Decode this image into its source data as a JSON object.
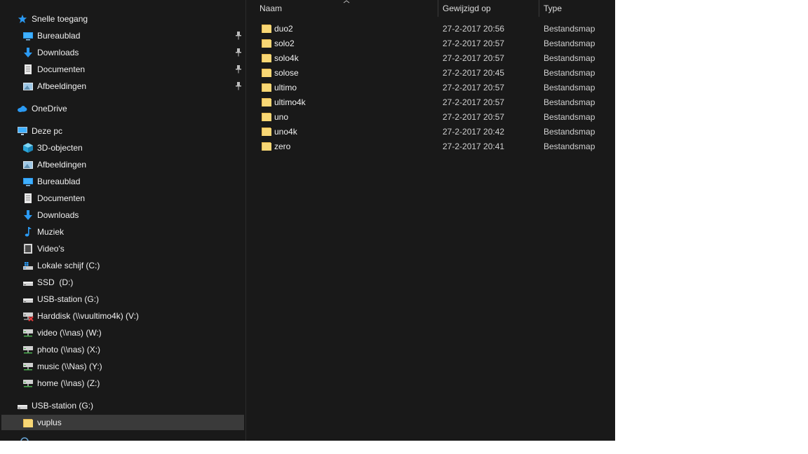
{
  "colors": {
    "background": "#191919",
    "selected": "#3a3a3a",
    "accent_blue": "#2b9af3",
    "folder_yellow": "#f8d775"
  },
  "nav": {
    "items": [
      {
        "label": "Snelle toegang",
        "icon": "star-icon",
        "level": 0,
        "pinned": false
      },
      {
        "label": "Bureaublad",
        "icon": "desktop-icon",
        "level": 1,
        "pinned": true
      },
      {
        "label": "Downloads",
        "icon": "download-arrow-icon",
        "level": 1,
        "pinned": true
      },
      {
        "label": "Documenten",
        "icon": "document-icon",
        "level": 1,
        "pinned": true
      },
      {
        "label": "Afbeeldingen",
        "icon": "pictures-icon",
        "level": 1,
        "pinned": true
      },
      {
        "label": "OneDrive",
        "icon": "cloud-icon",
        "level": 0,
        "pinned": false
      },
      {
        "label": "Deze pc",
        "icon": "computer-icon",
        "level": 0,
        "pinned": false
      },
      {
        "label": "3D-objecten",
        "icon": "cube-icon",
        "level": 1,
        "pinned": false
      },
      {
        "label": "Afbeeldingen",
        "icon": "pictures-icon",
        "level": 1,
        "pinned": false
      },
      {
        "label": "Bureaublad",
        "icon": "desktop-icon",
        "level": 1,
        "pinned": false
      },
      {
        "label": "Documenten",
        "icon": "document-icon",
        "level": 1,
        "pinned": false
      },
      {
        "label": "Downloads",
        "icon": "download-arrow-icon",
        "level": 1,
        "pinned": false
      },
      {
        "label": "Muziek",
        "icon": "music-note-icon",
        "level": 1,
        "pinned": false
      },
      {
        "label": "Video's",
        "icon": "film-icon",
        "level": 1,
        "pinned": false
      },
      {
        "label": "Lokale schijf (C:)",
        "icon": "windows-drive-icon",
        "level": 1,
        "pinned": false
      },
      {
        "label": "SSD  (D:)",
        "icon": "drive-icon",
        "level": 1,
        "pinned": false
      },
      {
        "label": "USB-station (G:)",
        "icon": "drive-icon",
        "level": 1,
        "pinned": false
      },
      {
        "label": "Harddisk (\\\\vuultimo4k) (V:)",
        "icon": "disconnected-network-drive-icon",
        "level": 1,
        "pinned": false
      },
      {
        "label": "video (\\\\nas) (W:)",
        "icon": "network-drive-icon",
        "level": 1,
        "pinned": false
      },
      {
        "label": "photo (\\\\nas) (X:)",
        "icon": "network-drive-icon",
        "level": 1,
        "pinned": false
      },
      {
        "label": "music (\\\\Nas) (Y:)",
        "icon": "network-drive-icon",
        "level": 1,
        "pinned": false
      },
      {
        "label": "home (\\\\nas) (Z:)",
        "icon": "network-drive-icon",
        "level": 1,
        "pinned": false
      },
      {
        "label": "USB-station (G:)",
        "icon": "drive-icon",
        "level": 0,
        "pinned": false
      },
      {
        "label": "vuplus",
        "icon": "folder-icon",
        "level": 1,
        "pinned": false,
        "selected": true
      }
    ]
  },
  "content": {
    "columns": {
      "name": "Naam",
      "modified": "Gewijzigd op",
      "type": "Type"
    },
    "rows": [
      {
        "name": "duo2",
        "modified": "27-2-2017 20:56",
        "type": "Bestandsmap"
      },
      {
        "name": "solo2",
        "modified": "27-2-2017 20:57",
        "type": "Bestandsmap"
      },
      {
        "name": "solo4k",
        "modified": "27-2-2017 20:57",
        "type": "Bestandsmap"
      },
      {
        "name": "solose",
        "modified": "27-2-2017 20:45",
        "type": "Bestandsmap"
      },
      {
        "name": "ultimo",
        "modified": "27-2-2017 20:57",
        "type": "Bestandsmap"
      },
      {
        "name": "ultimo4k",
        "modified": "27-2-2017 20:57",
        "type": "Bestandsmap"
      },
      {
        "name": "uno",
        "modified": "27-2-2017 20:57",
        "type": "Bestandsmap"
      },
      {
        "name": "uno4k",
        "modified": "27-2-2017 20:42",
        "type": "Bestandsmap"
      },
      {
        "name": "zero",
        "modified": "27-2-2017 20:41",
        "type": "Bestandsmap"
      }
    ]
  }
}
